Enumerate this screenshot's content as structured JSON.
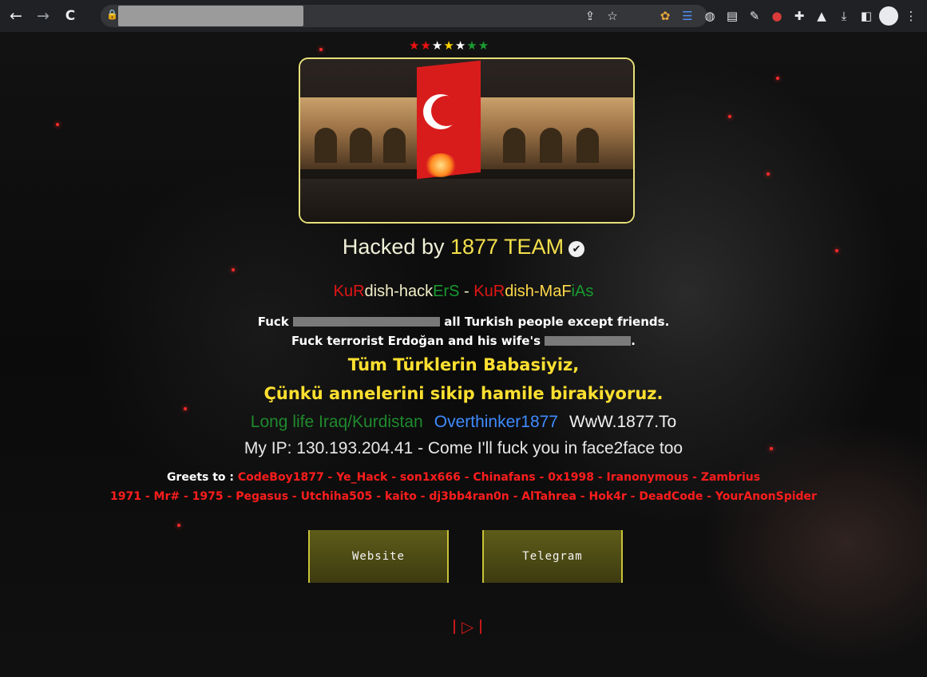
{
  "browser": {
    "back_icon": "←",
    "forward_icon": "→",
    "reload_icon": "C",
    "lock_icon": "🔒",
    "share_icon": "⇪",
    "star_icon": "☆",
    "extensions": [
      "cookie-icon",
      "list-icon",
      "globe-icon",
      "document-icon",
      "wand-icon",
      "red-ball-icon",
      "puzzle-icon",
      "flask-icon",
      "download-icon",
      "sidepanel-icon",
      "profile-icon",
      "menu-icon"
    ]
  },
  "page": {
    "stars": [
      "★",
      "★",
      "★",
      "★",
      "★",
      "★",
      "★"
    ],
    "title_prefix": "Hacked by ",
    "title_team": "1877 TEAM",
    "title_check": "✔",
    "subtitle": {
      "p1": "KuR",
      "p2": "dish-hack",
      "p3": "ErS",
      "sep": " - ",
      "p4": "KuR",
      "p5": "dish-MaF",
      "p6": "iAs"
    },
    "line1_a": "Fuck ",
    "line1_b": " all Turkish people except friends.",
    "line2_a": "Fuck terrorist Erdoğan and his wife's ",
    "line2_b": ".",
    "yellow1": "Tüm Türklerin Babasiyiz,",
    "yellow2": "Çünkü annelerini sikip hamile birakiyoruz.",
    "link1": "Long life Iraq/Kurdistan",
    "link2": "Overthinker1877",
    "link3": "WwW.1877.To",
    "ip_line": "My IP: 130.193.204.41 - Come I'll fuck you in face2face too",
    "greets_label": "Greets to : ",
    "greets1": "CodeBoy1877 - Ye_Hack - son1x666 - Chinafans - 0x1998 - Iranonymous - Zambrius",
    "greets2": "1971 - Mr# - 1975 - Pegasus - Utchiha505 - kaito - dj3bb4ran0n - AlTahrea - Hok4r - DeadCode - YourAnonSpider",
    "website_button": "Website",
    "telegram_button": "Telegram",
    "play_icon": "▷"
  },
  "colors": {
    "accent_yellow": "#f4e04a",
    "accent_red": "#e21515",
    "accent_green": "#169a2f",
    "accent_blue": "#3f8cff"
  }
}
